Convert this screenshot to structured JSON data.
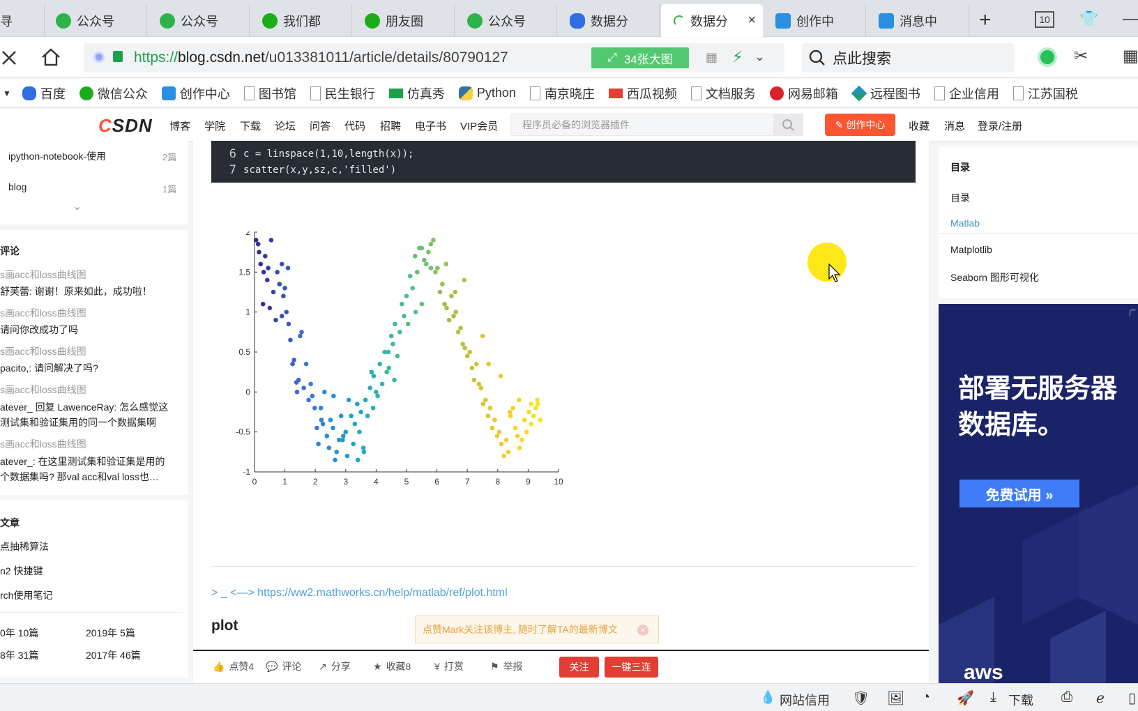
{
  "tabs": [
    {
      "label": "寻",
      "icon": "page-icon"
    },
    {
      "label": "公众号",
      "icon": "green-swirl-icon"
    },
    {
      "label": "公众号",
      "icon": "green-swirl-icon"
    },
    {
      "label": "我们都",
      "icon": "wechat-icon"
    },
    {
      "label": "朋友圈",
      "icon": "wechat-icon"
    },
    {
      "label": "公众号",
      "icon": "green-swirl-icon"
    },
    {
      "label": "数据分",
      "icon": "baidu-paw-icon"
    },
    {
      "label": "数据分",
      "icon": "loading-icon",
      "active": true,
      "close": "×"
    },
    {
      "label": "创作中",
      "icon": "tv-icon"
    },
    {
      "label": "消息中",
      "icon": "tv-icon"
    }
  ],
  "tabtools": {
    "new_tab": "+",
    "tab_count": "10"
  },
  "address": {
    "url_scheme": "https://",
    "url_host": "blog.csdn.net",
    "url_path": "/u013381011/article/details/80790127",
    "big_image": "34张大图",
    "search_placeholder": "点此搜索"
  },
  "bookmarks": [
    "百度",
    "微信公众",
    "创作中心",
    "图书馆",
    "民生银行",
    "仿真秀",
    "Python",
    "南京晓庄",
    "西瓜视频",
    "文档服务",
    "网易邮箱",
    "远程图书",
    "企业信用",
    "江苏国税"
  ],
  "csdn": {
    "logo_c": "C",
    "logo_rest": "SDN",
    "nav": [
      "博客",
      "学院",
      "下载",
      "论坛",
      "问答",
      "代码",
      "招聘",
      "电子书",
      "VIP会员"
    ],
    "search_placeholder": "程序员必备的浏览器插件",
    "create": "创作中心",
    "right": [
      "收藏",
      "消息",
      "登录/注册"
    ]
  },
  "sidebar": {
    "categories": [
      {
        "name": "ipython-notebook-使用",
        "count": "2篇"
      },
      {
        "name": "blog",
        "count": "1篇"
      }
    ],
    "comments_title": "评论",
    "comments": [
      {
        "article": "s画acc和loss曲线图",
        "text": "舒芙蕾: 谢谢！原来如此，成功啦！"
      },
      {
        "article": "s画acc和loss曲线图",
        "text": "请问你改成功了吗"
      },
      {
        "article": "s画acc和loss曲线图",
        "text": "pacito,: 请问解决了吗?"
      },
      {
        "article": "s画acc和loss曲线图",
        "text": "atever_ 回复 LawenceRay: 怎么感觉这",
        "text2": "测试集和验证集用的同一个数据集啊"
      },
      {
        "article": "s画acc和loss曲线图",
        "text": "atever_: 在这里测试集和验证集是用的",
        "text2": "个数据集吗? 那val acc和val loss也…"
      }
    ],
    "recent_title": "文章",
    "recent": [
      "点抽稀算法",
      "n2 快捷键",
      "rch使用笔记"
    ],
    "archive": [
      {
        "year": "0年",
        "count": "10篇"
      },
      {
        "year": "2019年",
        "count": "5篇"
      },
      {
        "year": "8年",
        "count": "31篇"
      },
      {
        "year": "2017年",
        "count": "46篇"
      }
    ]
  },
  "code": [
    {
      "ln": "6",
      "text": "c = linspace(1,10,length(x));"
    },
    {
      "ln": "7",
      "text": "scatter(x,y,sz,c,'filled')"
    }
  ],
  "chart_data": {
    "type": "scatter",
    "title": "",
    "xlabel": "",
    "ylabel": "",
    "xlim": [
      0,
      10
    ],
    "ylim": [
      -1,
      2
    ],
    "xticks": [
      "0",
      "1",
      "2",
      "3",
      "4",
      "5",
      "6",
      "7",
      "8",
      "9",
      "10"
    ],
    "yticks": [
      "-1",
      "-0.5",
      "0",
      "0.5",
      "1",
      "1.5",
      "2"
    ],
    "grid": false,
    "colormap": "parula",
    "x": [
      0.05,
      0.12,
      0.2,
      0.28,
      0.35,
      0.42,
      0.5,
      0.55,
      0.62,
      0.7,
      0.75,
      0.82,
      0.9,
      0.95,
      1.0,
      1.05,
      1.12,
      1.18,
      1.25,
      1.3,
      1.38,
      1.45,
      1.5,
      1.55,
      1.62,
      1.7,
      1.78,
      1.85,
      1.9,
      1.98,
      2.05,
      2.1,
      2.18,
      2.25,
      2.3,
      2.38,
      2.45,
      2.5,
      2.58,
      2.65,
      2.7,
      2.78,
      2.85,
      2.92,
      3.0,
      3.05,
      3.1,
      3.18,
      3.25,
      3.3,
      3.38,
      3.45,
      3.5,
      3.58,
      3.65,
      3.72,
      3.8,
      3.85,
      3.92,
      4.0,
      4.05,
      4.12,
      4.2,
      4.28,
      4.35,
      4.42,
      4.5,
      4.55,
      4.62,
      4.7,
      4.78,
      4.85,
      4.92,
      5.0,
      5.05,
      5.12,
      5.2,
      5.28,
      5.35,
      5.42,
      5.5,
      5.58,
      5.65,
      5.72,
      5.8,
      5.88,
      5.95,
      6.02,
      6.1,
      6.18,
      6.25,
      6.32,
      6.4,
      6.48,
      6.55,
      6.62,
      6.7,
      6.78,
      6.85,
      6.92,
      7.0,
      7.08,
      7.15,
      7.22,
      7.3,
      7.38,
      7.45,
      7.52,
      7.6,
      7.68,
      7.75,
      7.82,
      7.9,
      7.98,
      8.05,
      8.12,
      8.2,
      8.28,
      8.35,
      8.42,
      8.5,
      8.58,
      8.65,
      8.72,
      8.8,
      8.88,
      8.95,
      9.02,
      9.1,
      9.18,
      9.25,
      9.32,
      9.4,
      0.15,
      0.45,
      0.9,
      1.4,
      2.2,
      2.9,
      3.4,
      3.9,
      4.6,
      5.3,
      5.8,
      6.3,
      6.9,
      7.5,
      8.1,
      8.7,
      9.1,
      0.3,
      1.1,
      2.6,
      3.6,
      4.4,
      5.5,
      6.6,
      7.7,
      8.4,
      9.3
    ],
    "y": [
      1.9,
      1.85,
      1.6,
      1.1,
      1.7,
      1.4,
      1.05,
      1.9,
      1.25,
      0.9,
      1.5,
      1.35,
      1.6,
      1.2,
      1.3,
      1.0,
      0.85,
      0.65,
      0.35,
      0.4,
      0.12,
      0.15,
      0.7,
      0.75,
      0.05,
      0.35,
      -0.1,
      0.1,
      -0.05,
      -0.2,
      -0.45,
      -0.65,
      -0.2,
      -0.4,
      0.0,
      -0.55,
      -0.7,
      -0.35,
      -0.45,
      -0.85,
      -0.75,
      -0.6,
      -0.3,
      -0.55,
      -0.5,
      -0.8,
      -0.1,
      -0.3,
      -0.65,
      -0.4,
      -0.15,
      -0.5,
      -0.25,
      -0.7,
      -0.1,
      -0.3,
      0.05,
      0.25,
      0.2,
      0.0,
      -0.05,
      0.35,
      0.1,
      0.5,
      0.25,
      0.3,
      0.7,
      0.6,
      0.85,
      0.45,
      0.75,
      1.1,
      0.95,
      1.2,
      0.85,
      1.45,
      1.3,
      1.7,
      1.5,
      1.8,
      1.8,
      1.65,
      1.6,
      1.75,
      1.85,
      1.9,
      1.5,
      1.55,
      1.25,
      1.35,
      1.1,
      1.05,
      0.9,
      1.2,
      0.95,
      1.0,
      0.75,
      0.8,
      0.6,
      0.55,
      0.45,
      0.5,
      0.3,
      0.15,
      0.35,
      0.1,
      0.05,
      -0.15,
      -0.1,
      -0.3,
      -0.2,
      -0.45,
      -0.35,
      -0.55,
      -0.5,
      -0.65,
      -0.8,
      -0.6,
      -0.75,
      -0.3,
      -0.2,
      -0.45,
      -0.55,
      -0.7,
      -0.6,
      -0.35,
      -0.5,
      -0.25,
      -0.4,
      -0.3,
      -0.2,
      -0.15,
      -0.35,
      1.75,
      1.55,
      0.95,
      0.0,
      -0.35,
      -0.6,
      -0.85,
      -0.2,
      0.15,
      1.0,
      1.55,
      1.6,
      1.4,
      0.7,
      0.2,
      -0.1,
      -0.15,
      1.5,
      1.55,
      -0.05,
      -0.75,
      0.5,
      1.1,
      1.25,
      0.35,
      -0.25,
      -0.1
    ]
  },
  "link": "> _ <—> https://ww2.mathworks.cn/help/matlab/ref/plot.html",
  "section_title": "plot",
  "tip": "点赞Mark关注该博主, 随时了解TA的最新博文",
  "toolbar": {
    "like": "点赞4",
    "comment": "评论",
    "share": "分享",
    "fav": "收藏8",
    "reward": "打赏",
    "report": "举报",
    "follow": "关注",
    "triple": "一键三连"
  },
  "toc": {
    "title": "目录",
    "items": [
      "目录",
      "Matlab",
      "Matplotlib",
      "Seaborn 图形可视化"
    ]
  },
  "ad": {
    "line1": "部署无服务器",
    "line2": "数据库。",
    "button": "免费试用 »",
    "brand": "aws"
  },
  "status": {
    "credit": "网站信用",
    "download": "下载"
  }
}
